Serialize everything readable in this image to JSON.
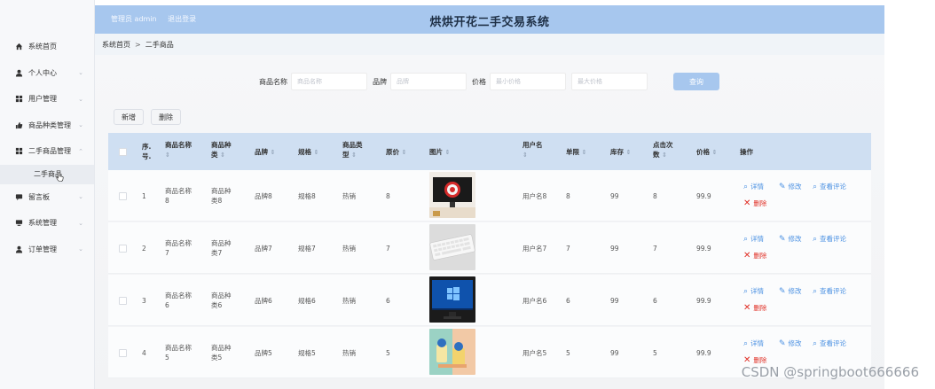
{
  "app": {
    "title": "烘烘开花二手交易系统",
    "admin_text": "管理员 admin",
    "logout": "退出登录"
  },
  "sidebar": {
    "items": [
      {
        "label": "系统首页",
        "icon": "home-icon"
      },
      {
        "label": "个人中心",
        "icon": "user-icon"
      },
      {
        "label": "用户管理",
        "icon": "grid-icon"
      },
      {
        "label": "商品种类管理",
        "icon": "thumb-icon"
      },
      {
        "label": "二手商品管理",
        "icon": "grid-icon"
      },
      {
        "label": "留言板",
        "icon": "message-icon"
      },
      {
        "label": "系统管理",
        "icon": "system-icon"
      },
      {
        "label": "订单管理",
        "icon": "user-icon"
      }
    ],
    "sub_active": "二手商品"
  },
  "breadcrumb": {
    "home": "系统首页",
    "sep": ">",
    "current": "二手商品"
  },
  "search": {
    "name_label": "商品名称",
    "name_placeholder": "商品名称",
    "brand_label": "品牌",
    "brand_placeholder": "品牌",
    "price_label": "价格",
    "min_placeholder": "最小价格",
    "max_placeholder": "最大价格",
    "button": "查询"
  },
  "actions": {
    "add": "新增",
    "delete": "删除"
  },
  "table": {
    "headers": {
      "index": [
        "序.",
        "号."
      ],
      "name": [
        "商品名称"
      ],
      "category": [
        "商品种",
        "类"
      ],
      "brand": [
        "品牌"
      ],
      "spec": [
        "规格"
      ],
      "type": [
        "商品类",
        "型"
      ],
      "orig_price": [
        "原价"
      ],
      "image": [
        "图片"
      ],
      "username": [
        "用户名"
      ],
      "unit": [
        "单限"
      ],
      "stock": [
        "库存"
      ],
      "clicks": [
        "点击次",
        "数"
      ],
      "price": [
        "价格"
      ],
      "ops": "操作"
    },
    "sort_glyph": "⇕",
    "rows": [
      {
        "index": "1",
        "name": [
          "商品名称",
          "8"
        ],
        "category": [
          "商品种",
          "类8"
        ],
        "brand": "品牌8",
        "spec": "规格8",
        "type": "热销",
        "orig_price": "8",
        "username": "用户名8",
        "unit": "8",
        "stock": "99",
        "clicks": "8",
        "price": "99.9",
        "img": "monitor-photo"
      },
      {
        "index": "2",
        "name": [
          "商品名称",
          "7"
        ],
        "category": [
          "商品种",
          "类7"
        ],
        "brand": "品牌7",
        "spec": "规格7",
        "type": "热销",
        "orig_price": "7",
        "username": "用户名7",
        "unit": "7",
        "stock": "99",
        "clicks": "7",
        "price": "99.9",
        "img": "keyboard-photo"
      },
      {
        "index": "3",
        "name": [
          "商品名称",
          "6"
        ],
        "category": [
          "商品种",
          "类6"
        ],
        "brand": "品牌6",
        "spec": "规格6",
        "type": "热销",
        "orig_price": "6",
        "username": "用户名6",
        "unit": "6",
        "stock": "99",
        "clicks": "6",
        "price": "99.9",
        "img": "windows-monitor-photo"
      },
      {
        "index": "4",
        "name": [
          "商品名称",
          "5"
        ],
        "category": [
          "商品种",
          "类5"
        ],
        "brand": "品牌5",
        "spec": "规格5",
        "type": "热销",
        "orig_price": "5",
        "username": "用户名5",
        "unit": "5",
        "stock": "99",
        "clicks": "5",
        "price": "99.9",
        "img": "cups-photo"
      }
    ],
    "ops": {
      "detail": "详情",
      "edit": "修改",
      "review": "查看评论",
      "delete": "删除"
    }
  },
  "watermark": "CSDN @springboot666666"
}
